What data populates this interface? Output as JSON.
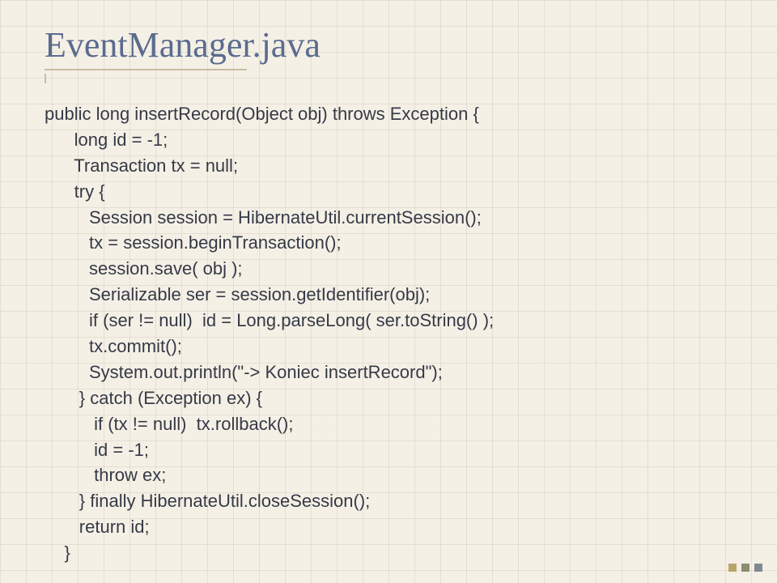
{
  "title": "EventManager.java",
  "code": "public long insertRecord(Object obj) throws Exception {\n      long id = -1;\n      Transaction tx = null;\n      try {\n         Session session = HibernateUtil.currentSession();\n         tx = session.beginTransaction();\n         session.save( obj );\n         Serializable ser = session.getIdentifier(obj);\n         if (ser != null)  id = Long.parseLong( ser.toString() );\n         tx.commit();\n         System.out.println(\"-> Koniec insertRecord\");\n       } catch (Exception ex) {\n          if (tx != null)  tx.rollback();\n          id = -1;\n          throw ex;\n       } finally HibernateUtil.closeSession();\n       return id;\n    }"
}
